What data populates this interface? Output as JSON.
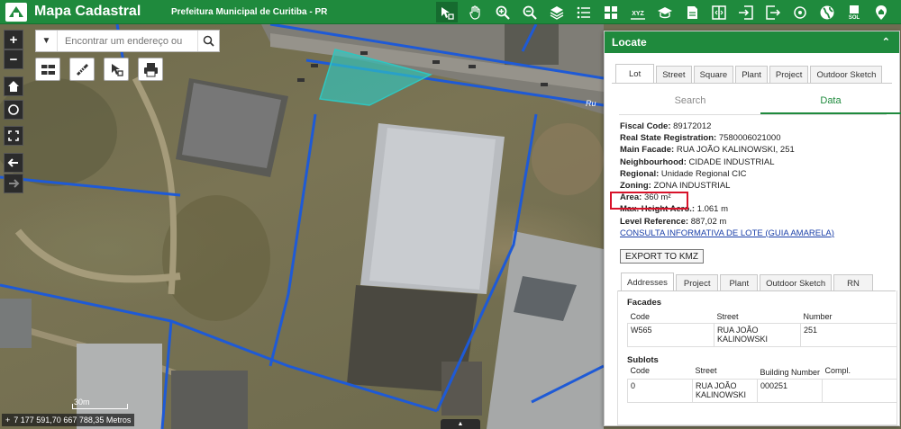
{
  "header": {
    "app_title": "Mapa Cadastral",
    "org_title": "Prefeitura Municipal de Curitiba - PR",
    "toolbar_icons": [
      "locate-icon",
      "pan-hand-icon",
      "zoom-in-icon",
      "zoom-out-icon",
      "layers-icon",
      "list-icon",
      "grid-icon",
      "xyz-icon",
      "graduation-cap-icon",
      "print-map-icon",
      "split-view-icon",
      "login-icon",
      "logout-icon",
      "target-icon",
      "globe-icon",
      "sol-icon",
      "home-pin-icon"
    ],
    "xyz_label": "XYZ",
    "sol_label": "SOL"
  },
  "map": {
    "search_placeholder": "Encontrar um endereço ou",
    "road_label": "Ru",
    "coords": "7 177 591,70 667 788,35 Metros",
    "scale_label": "30m"
  },
  "panel": {
    "title": "Locate",
    "tabs": [
      "Lot",
      "Street",
      "Square",
      "Plant",
      "Project",
      "Outdoor Sketch"
    ],
    "active_tab": "Lot",
    "segments": [
      "Search",
      "Data"
    ],
    "active_segment": "Data",
    "fields": [
      {
        "label": "Fiscal Code:",
        "value": "89172012"
      },
      {
        "label": "Real State Registration:",
        "value": "7580006021000"
      },
      {
        "label": "Main Facade:",
        "value": "RUA JOÃO KALINOWSKI, 251"
      },
      {
        "label": "Neighbourhood:",
        "value": "CIDADE INDUSTRIAL"
      },
      {
        "label": "Regional:",
        "value": "Unidade Regional CIC"
      },
      {
        "label": "Zoning:",
        "value": "ZONA INDUSTRIAL"
      },
      {
        "label": "Area:",
        "value": "360 m²"
      },
      {
        "label": "Max. Height Aero.:",
        "value": "1.061 m"
      },
      {
        "label": "Level Reference:",
        "value": "887,02 m"
      }
    ],
    "link": "CONSULTA INFORMATIVA DE LOTE (GUIA AMARELA)",
    "export_label": "EXPORT TO KMZ",
    "sub_tabs": [
      "Addresses",
      "Project",
      "Plant",
      "Outdoor Sketch",
      "RN"
    ],
    "active_sub_tab": "Addresses",
    "facades": {
      "title": "Facades",
      "headers": [
        "Code",
        "Street",
        "Number"
      ],
      "rows": [
        [
          "W565",
          "RUA JOÃO KALINOWSKI",
          "251"
        ]
      ]
    },
    "sublots": {
      "title": "Sublots",
      "headers": [
        "Code",
        "Street",
        "Building Number",
        "Compl."
      ],
      "rows": [
        [
          "0",
          "RUA JOÃO KALINOWSKI",
          "000251",
          ""
        ]
      ]
    }
  },
  "colors": {
    "brand_green": "#1f8a3d",
    "lot_outline": "#1e5ad6",
    "selection_fill": "#2fc6c0",
    "highlight_red": "#d8132a"
  }
}
